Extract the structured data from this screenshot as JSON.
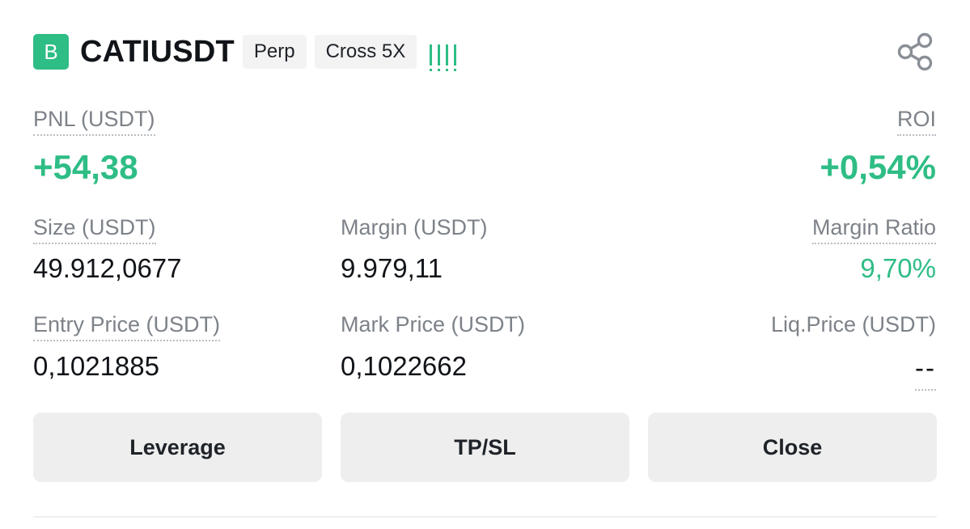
{
  "position": {
    "side_letter": "B",
    "symbol": "CATIUSDT",
    "tags": [
      "Perp",
      "Cross 5X"
    ],
    "risk_indicator": "!!!!",
    "share_icon": "share-icon"
  },
  "stats": {
    "pnl": {
      "label": "PNL (USDT)",
      "value": "+54,38"
    },
    "roi": {
      "label": "ROI",
      "value": "+0,54%"
    },
    "size": {
      "label": "Size (USDT)",
      "value": "49.912,0677"
    },
    "margin": {
      "label": "Margin (USDT)",
      "value": "9.979,11"
    },
    "margin_ratio": {
      "label": "Margin Ratio",
      "value": "9,70%"
    },
    "entry_price": {
      "label": "Entry Price (USDT)",
      "value": "0,1021885"
    },
    "mark_price": {
      "label": "Mark Price (USDT)",
      "value": "0,1022662"
    },
    "liq_price": {
      "label": "Liq.Price (USDT)",
      "value": "--"
    }
  },
  "actions": {
    "leverage_label": "Leverage",
    "tpsl_label": "TP/SL",
    "close_label": "Close"
  },
  "colors": {
    "positive": "#2ebd85",
    "button_bg": "#eeeeee",
    "tag_bg": "#f3f3f3"
  }
}
